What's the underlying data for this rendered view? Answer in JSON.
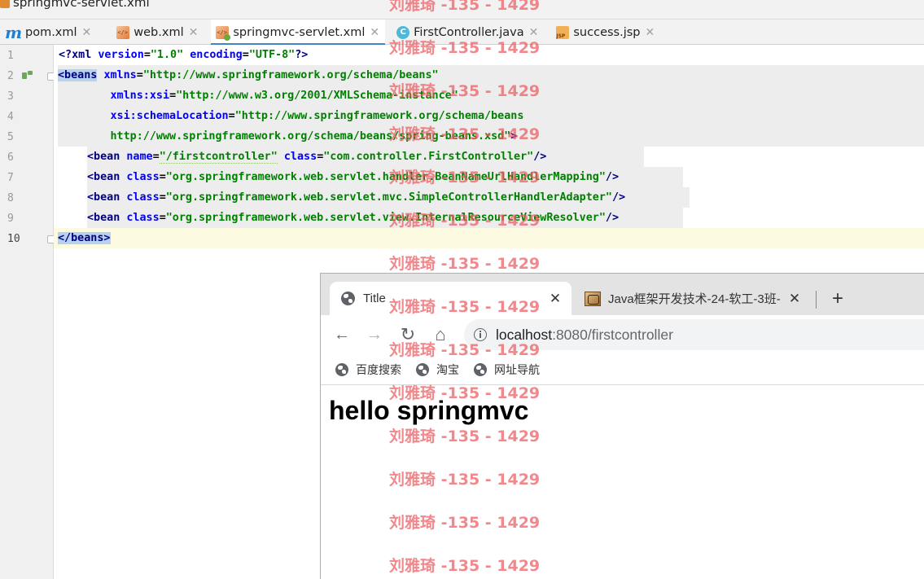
{
  "ide": {
    "window_title": "springmvc-servlet.xml",
    "tabs": [
      {
        "label": "pom.xml",
        "icon": "maven-icon"
      },
      {
        "label": "web.xml",
        "icon": "xml-file-icon"
      },
      {
        "label": "springmvc-servlet.xml",
        "icon": "spring-xml-icon",
        "active": true
      },
      {
        "label": "FirstController.java",
        "icon": "java-class-icon"
      },
      {
        "label": "success.jsp",
        "icon": "jsp-file-icon"
      }
    ],
    "line_numbers": [
      "1",
      "2",
      "3",
      "4",
      "5",
      "6",
      "7",
      "8",
      "9",
      "10"
    ],
    "code": {
      "l1": {
        "open": "<?",
        "tag": "xml",
        "a1": "version",
        "v1": "\"1.0\"",
        "a2": "encoding",
        "v2": "\"UTF-8\"",
        "close": "?>"
      },
      "l2": {
        "tag": "<beans",
        "attr": "xmlns",
        "val": "\"http://www.springframework.org/schema/beans\""
      },
      "l3": {
        "attr": "xmlns:xsi",
        "val": "\"http://www.w3.org/2001/XMLSchema-instance\""
      },
      "l4": {
        "attr": "xsi:schemaLocation",
        "val": "\"http://www.springframework.org/schema/beans"
      },
      "l5": {
        "val": "http://www.springframework.org/schema/beans/spring-beans.xsd\"",
        "close": ">"
      },
      "l6": {
        "tag": "<bean",
        "a1": "name",
        "v1": "\"/firstcontroller\"",
        "a2": "class",
        "v2": "\"com.controller.FirstController\"",
        "close": "/>"
      },
      "l7": {
        "tag": "<bean",
        "attr": "class",
        "val": "\"org.springframework.web.servlet.handler.BeanNameUrlHandlerMapping\"",
        "close": "/>"
      },
      "l8": {
        "tag": "<bean",
        "attr": "class",
        "val": "\"org.springframework.web.servlet.mvc.SimpleControllerHandlerAdapter\"",
        "close": "/>"
      },
      "l9": {
        "tag": "<bean",
        "attr": "class",
        "val": "\"org.springframework.web.servlet.view.InternalResourceViewResolver\"",
        "close": "/>"
      },
      "l10": {
        "tag": "</beans>"
      }
    }
  },
  "browser": {
    "tabs": [
      {
        "title": "Title",
        "close": "✕"
      },
      {
        "title": "Java框架开发技术-24-软工-3班-",
        "close": "✕"
      }
    ],
    "new_tab": "+",
    "nav": {
      "back": "←",
      "forward": "→",
      "reload": "↻",
      "home": "⌂"
    },
    "url_host": "localhost",
    "url_rest": ":8080/firstcontroller",
    "bookmarks": [
      "百度搜索",
      "淘宝",
      "网址导航"
    ],
    "page_heading": "hello springmvc"
  },
  "watermark": "刘雅琦 -135 - 1429"
}
